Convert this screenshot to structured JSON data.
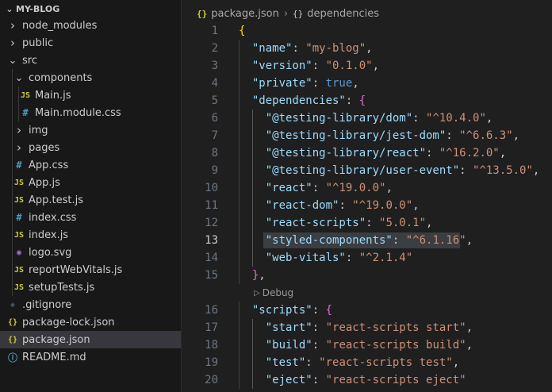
{
  "explorer": {
    "root_label": "MY-BLOG",
    "items": [
      {
        "label": "node_modules",
        "type": "folder",
        "depth": 1,
        "expanded": false
      },
      {
        "label": "public",
        "type": "folder",
        "depth": 1,
        "expanded": false
      },
      {
        "label": "src",
        "type": "folder",
        "depth": 1,
        "expanded": true
      },
      {
        "label": "components",
        "type": "folder",
        "depth": 2,
        "expanded": true
      },
      {
        "label": "Main.js",
        "type": "js",
        "depth": 3
      },
      {
        "label": "Main.module.css",
        "type": "css",
        "depth": 3
      },
      {
        "label": "img",
        "type": "folder",
        "depth": 2,
        "expanded": false
      },
      {
        "label": "pages",
        "type": "folder",
        "depth": 2,
        "expanded": false
      },
      {
        "label": "App.css",
        "type": "css",
        "depth": 2
      },
      {
        "label": "App.js",
        "type": "js",
        "depth": 2
      },
      {
        "label": "App.test.js",
        "type": "test",
        "depth": 2
      },
      {
        "label": "index.css",
        "type": "css",
        "depth": 2
      },
      {
        "label": "index.js",
        "type": "js",
        "depth": 2
      },
      {
        "label": "logo.svg",
        "type": "svg",
        "depth": 2
      },
      {
        "label": "reportWebVitals.js",
        "type": "js",
        "depth": 2
      },
      {
        "label": "setupTests.js",
        "type": "js",
        "depth": 2
      },
      {
        "label": ".gitignore",
        "type": "git",
        "depth": 1
      },
      {
        "label": "package-lock.json",
        "type": "json",
        "depth": 1
      },
      {
        "label": "package.json",
        "type": "json",
        "depth": 1,
        "selected": true
      },
      {
        "label": "README.md",
        "type": "info",
        "depth": 1
      }
    ]
  },
  "breadcrumb": {
    "file": "package.json",
    "symbol": "dependencies",
    "file_icon": "{}",
    "symbol_icon": "{}"
  },
  "icons": {
    "js": "JS",
    "css": "#",
    "json": "{}",
    "git": "◆",
    "info": "ⓘ",
    "svg": "◉",
    "test": "JS"
  },
  "editor": {
    "active_line": "13",
    "codelens": "Debug",
    "lines": [
      {
        "n": "1",
        "tokens": [
          [
            "b1",
            "{"
          ]
        ]
      },
      {
        "n": "2",
        "tokens": [
          [
            "p",
            "  "
          ],
          [
            "key",
            "\"name\""
          ],
          [
            "p",
            ": "
          ],
          [
            "str",
            "\"my-blog\""
          ],
          [
            "p",
            ","
          ]
        ]
      },
      {
        "n": "3",
        "tokens": [
          [
            "p",
            "  "
          ],
          [
            "key",
            "\"version\""
          ],
          [
            "p",
            ": "
          ],
          [
            "str",
            "\"0.1.0\""
          ],
          [
            "p",
            ","
          ]
        ]
      },
      {
        "n": "4",
        "tokens": [
          [
            "p",
            "  "
          ],
          [
            "key",
            "\"private\""
          ],
          [
            "p",
            ": "
          ],
          [
            "bool",
            "true"
          ],
          [
            "p",
            ","
          ]
        ]
      },
      {
        "n": "5",
        "tokens": [
          [
            "p",
            "  "
          ],
          [
            "key",
            "\"dependencies\""
          ],
          [
            "p",
            ": "
          ],
          [
            "b2",
            "{"
          ]
        ]
      },
      {
        "n": "6",
        "tokens": [
          [
            "p",
            "    "
          ],
          [
            "key",
            "\"@testing-library/dom\""
          ],
          [
            "p",
            ": "
          ],
          [
            "str",
            "\"^10.4.0\""
          ],
          [
            "p",
            ","
          ]
        ]
      },
      {
        "n": "7",
        "tokens": [
          [
            "p",
            "    "
          ],
          [
            "key",
            "\"@testing-library/jest-dom\""
          ],
          [
            "p",
            ": "
          ],
          [
            "str",
            "\"^6.6.3\""
          ],
          [
            "p",
            ","
          ]
        ]
      },
      {
        "n": "8",
        "tokens": [
          [
            "p",
            "    "
          ],
          [
            "key",
            "\"@testing-library/react\""
          ],
          [
            "p",
            ": "
          ],
          [
            "str",
            "\"^16.2.0\""
          ],
          [
            "p",
            ","
          ]
        ]
      },
      {
        "n": "9",
        "tokens": [
          [
            "p",
            "    "
          ],
          [
            "key",
            "\"@testing-library/user-event\""
          ],
          [
            "p",
            ": "
          ],
          [
            "str",
            "\"^13.5.0\""
          ],
          [
            "p",
            ","
          ]
        ]
      },
      {
        "n": "10",
        "tokens": [
          [
            "p",
            "    "
          ],
          [
            "key",
            "\"react\""
          ],
          [
            "p",
            ": "
          ],
          [
            "str",
            "\"^19.0.0\""
          ],
          [
            "p",
            ","
          ]
        ]
      },
      {
        "n": "11",
        "tokens": [
          [
            "p",
            "    "
          ],
          [
            "key",
            "\"react-dom\""
          ],
          [
            "p",
            ": "
          ],
          [
            "str",
            "\"^19.0.0\""
          ],
          [
            "p",
            ","
          ]
        ]
      },
      {
        "n": "12",
        "tokens": [
          [
            "p",
            "    "
          ],
          [
            "key",
            "\"react-scripts\""
          ],
          [
            "p",
            ": "
          ],
          [
            "str",
            "\"5.0.1\""
          ],
          [
            "p",
            ","
          ]
        ]
      },
      {
        "n": "13",
        "tokens": [
          [
            "p",
            "    "
          ],
          [
            "key",
            "\"styled-components\""
          ],
          [
            "p",
            ": "
          ],
          [
            "str",
            "\"^6.1.16\""
          ],
          [
            "p",
            ","
          ]
        ]
      },
      {
        "n": "14",
        "tokens": [
          [
            "p",
            "    "
          ],
          [
            "key",
            "\"web-vitals\""
          ],
          [
            "p",
            ": "
          ],
          [
            "str",
            "\"^2.1.4\""
          ]
        ]
      },
      {
        "n": "15",
        "tokens": [
          [
            "p",
            "  "
          ],
          [
            "b2",
            "}"
          ],
          [
            "p",
            ","
          ]
        ]
      },
      {
        "lens": true
      },
      {
        "n": "16",
        "tokens": [
          [
            "p",
            "  "
          ],
          [
            "key",
            "\"scripts\""
          ],
          [
            "p",
            ": "
          ],
          [
            "b2",
            "{"
          ]
        ]
      },
      {
        "n": "17",
        "tokens": [
          [
            "p",
            "    "
          ],
          [
            "key",
            "\"start\""
          ],
          [
            "p",
            ": "
          ],
          [
            "str",
            "\"react-scripts start\""
          ],
          [
            "p",
            ","
          ]
        ]
      },
      {
        "n": "18",
        "tokens": [
          [
            "p",
            "    "
          ],
          [
            "key",
            "\"build\""
          ],
          [
            "p",
            ": "
          ],
          [
            "str",
            "\"react-scripts build\""
          ],
          [
            "p",
            ","
          ]
        ]
      },
      {
        "n": "19",
        "tokens": [
          [
            "p",
            "    "
          ],
          [
            "key",
            "\"test\""
          ],
          [
            "p",
            ": "
          ],
          [
            "str",
            "\"react-scripts test\""
          ],
          [
            "p",
            ","
          ]
        ]
      },
      {
        "n": "20",
        "tokens": [
          [
            "p",
            "    "
          ],
          [
            "key",
            "\"eject\""
          ],
          [
            "p",
            ": "
          ],
          [
            "str",
            "\"react-scripts eject\""
          ]
        ]
      }
    ]
  }
}
